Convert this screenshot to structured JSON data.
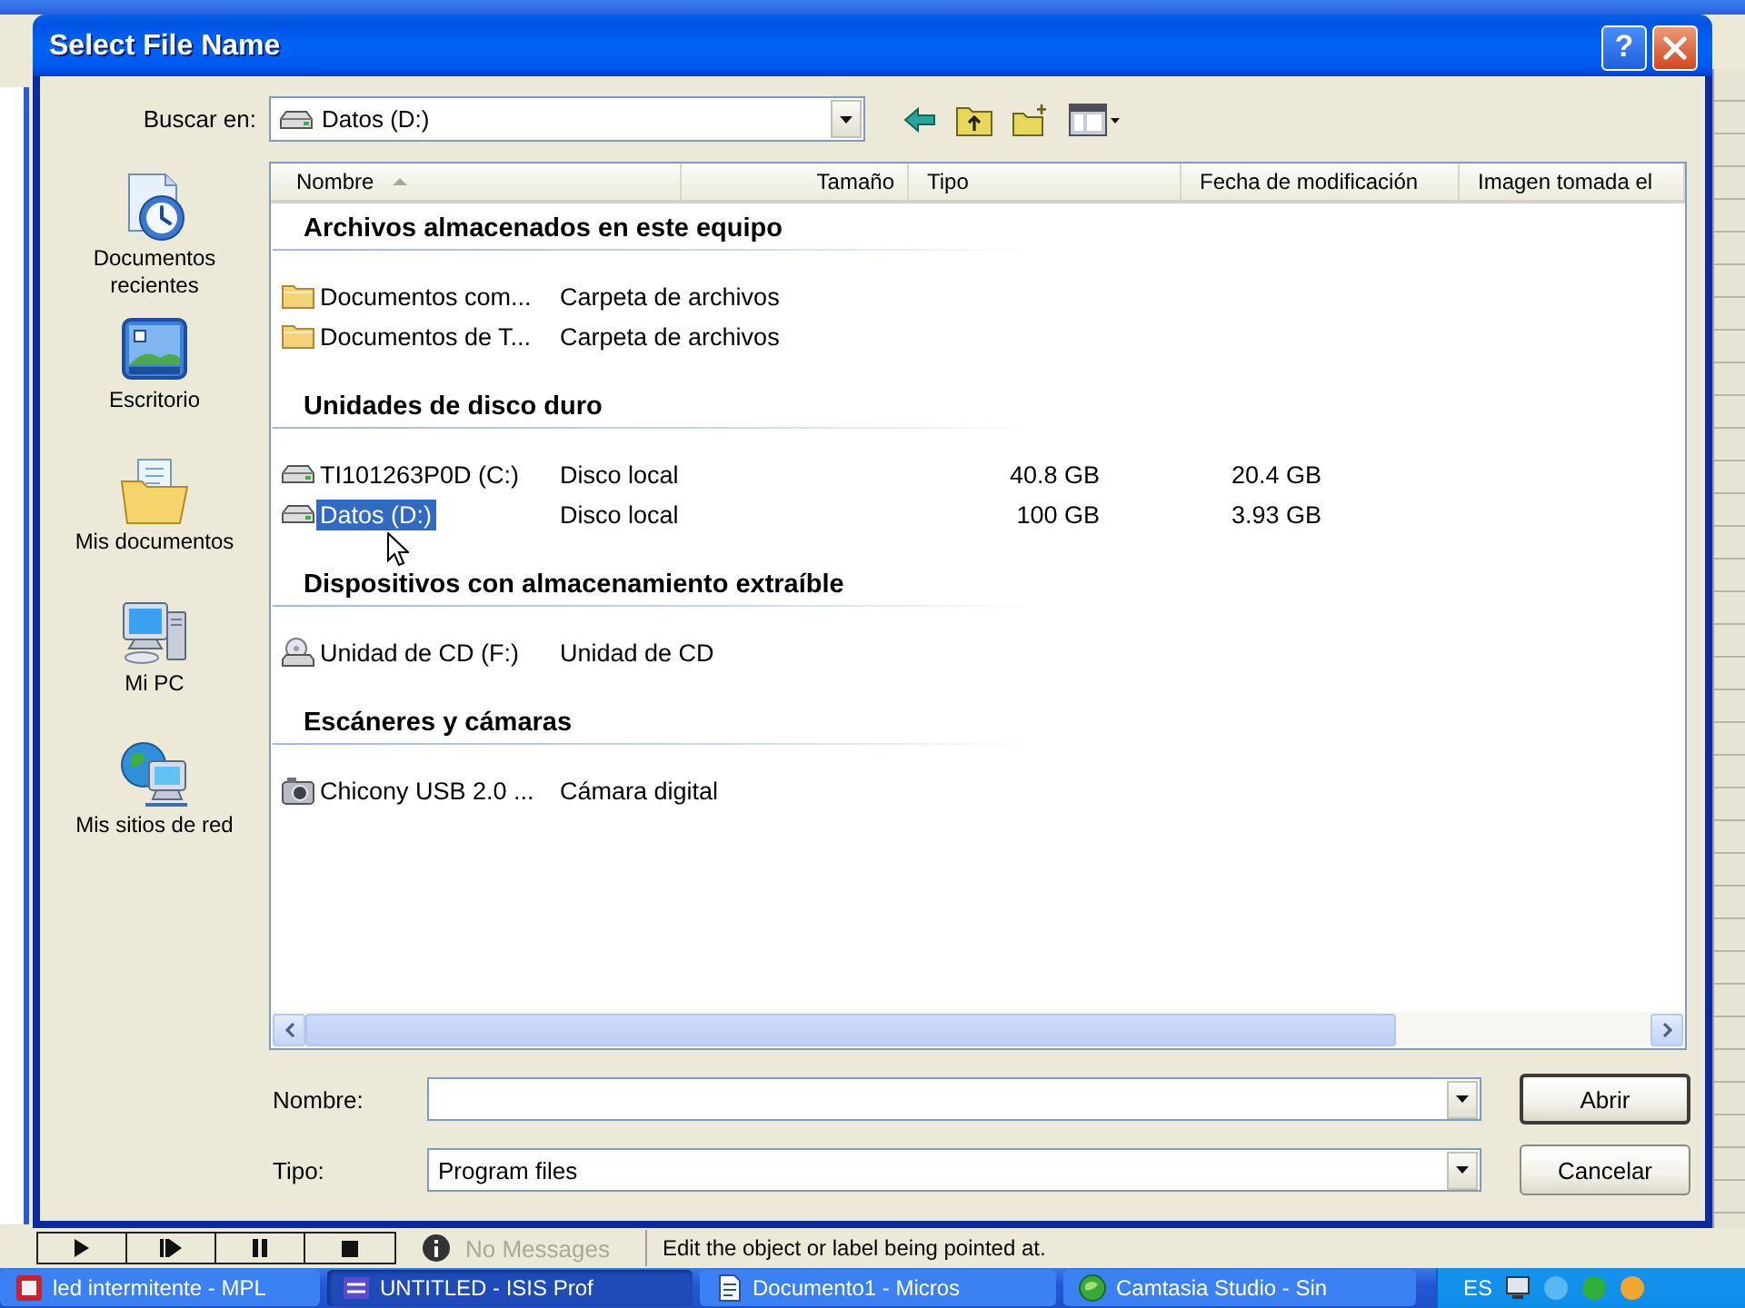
{
  "background_app": {
    "status_bar": {
      "controls": [
        {
          "kind": "play"
        },
        {
          "kind": "step"
        },
        {
          "kind": "pause"
        },
        {
          "kind": "stop"
        }
      ],
      "message": "No Messages",
      "hint": "Edit the object or label being pointed at."
    }
  },
  "dialog": {
    "title": "Select File Name",
    "help_label": "?",
    "look_in": {
      "label": "Buscar en:",
      "value": "Datos (D:)"
    },
    "places": [
      {
        "kind": "recent",
        "label": "Documentos recientes"
      },
      {
        "kind": "desktop",
        "label": "Escritorio"
      },
      {
        "kind": "documents",
        "label": "Mis documentos"
      },
      {
        "kind": "computer",
        "label": "Mi PC"
      },
      {
        "kind": "network",
        "label": "Mis sitios de red"
      }
    ],
    "columns": [
      {
        "label": "Nombre",
        "sorted": true
      },
      {
        "label": "Tamaño",
        "sorted": false
      },
      {
        "label": "Tipo",
        "sorted": false
      },
      {
        "label": "Fecha de modificación",
        "sorted": false
      },
      {
        "label": "Imagen tomada el",
        "sorted": false
      }
    ],
    "groups": [
      {
        "title": "Archivos almacenados en este equipo",
        "items": [
          {
            "kind": "folder",
            "name": "Documentos com...",
            "type": "Carpeta de archivos",
            "selected": false
          },
          {
            "kind": "folder",
            "name": "Documentos de T...",
            "type": "Carpeta de archivos",
            "selected": false
          }
        ]
      },
      {
        "title": "Unidades de disco duro",
        "items": [
          {
            "kind": "drive",
            "name": "TI101263P0D (C:)",
            "type": "Disco local",
            "column_3": "40.8 GB",
            "column_4": "20.4 GB",
            "selected": false
          },
          {
            "kind": "drive",
            "name": "Datos (D:)",
            "type": "Disco local",
            "column_3": "100 GB",
            "column_4": "3.93 GB",
            "selected": true
          }
        ]
      },
      {
        "title": "Dispositivos con almacenamiento extraíble",
        "items": [
          {
            "kind": "cd",
            "name": "Unidad de CD (F:)",
            "type": "Unidad de CD",
            "selected": false
          }
        ]
      },
      {
        "title": "Escáneres y cámaras",
        "items": [
          {
            "kind": "camera",
            "name": "Chicony USB 2.0 ...",
            "type": "Cámara digital",
            "selected": false
          }
        ]
      }
    ],
    "file_name": {
      "label": "Nombre:"
    },
    "file_type": {
      "label": "Tipo:",
      "value": "Program files"
    },
    "buttons": [
      {
        "label": "Abrir",
        "default": true
      },
      {
        "label": "Cancelar",
        "default": false
      }
    ]
  },
  "taskbar": {
    "items": [
      {
        "kind": "chip",
        "label": "led intermitente - MPL",
        "selected": false
      },
      {
        "kind": "board",
        "label": "UNTITLED - ISIS Prof",
        "selected": true
      },
      {
        "kind": "document",
        "label": "Documento1 - Micros",
        "selected": false
      },
      {
        "kind": "globe",
        "label": "Camtasia Studio - Sin",
        "selected": false
      }
    ],
    "language": "ES"
  }
}
